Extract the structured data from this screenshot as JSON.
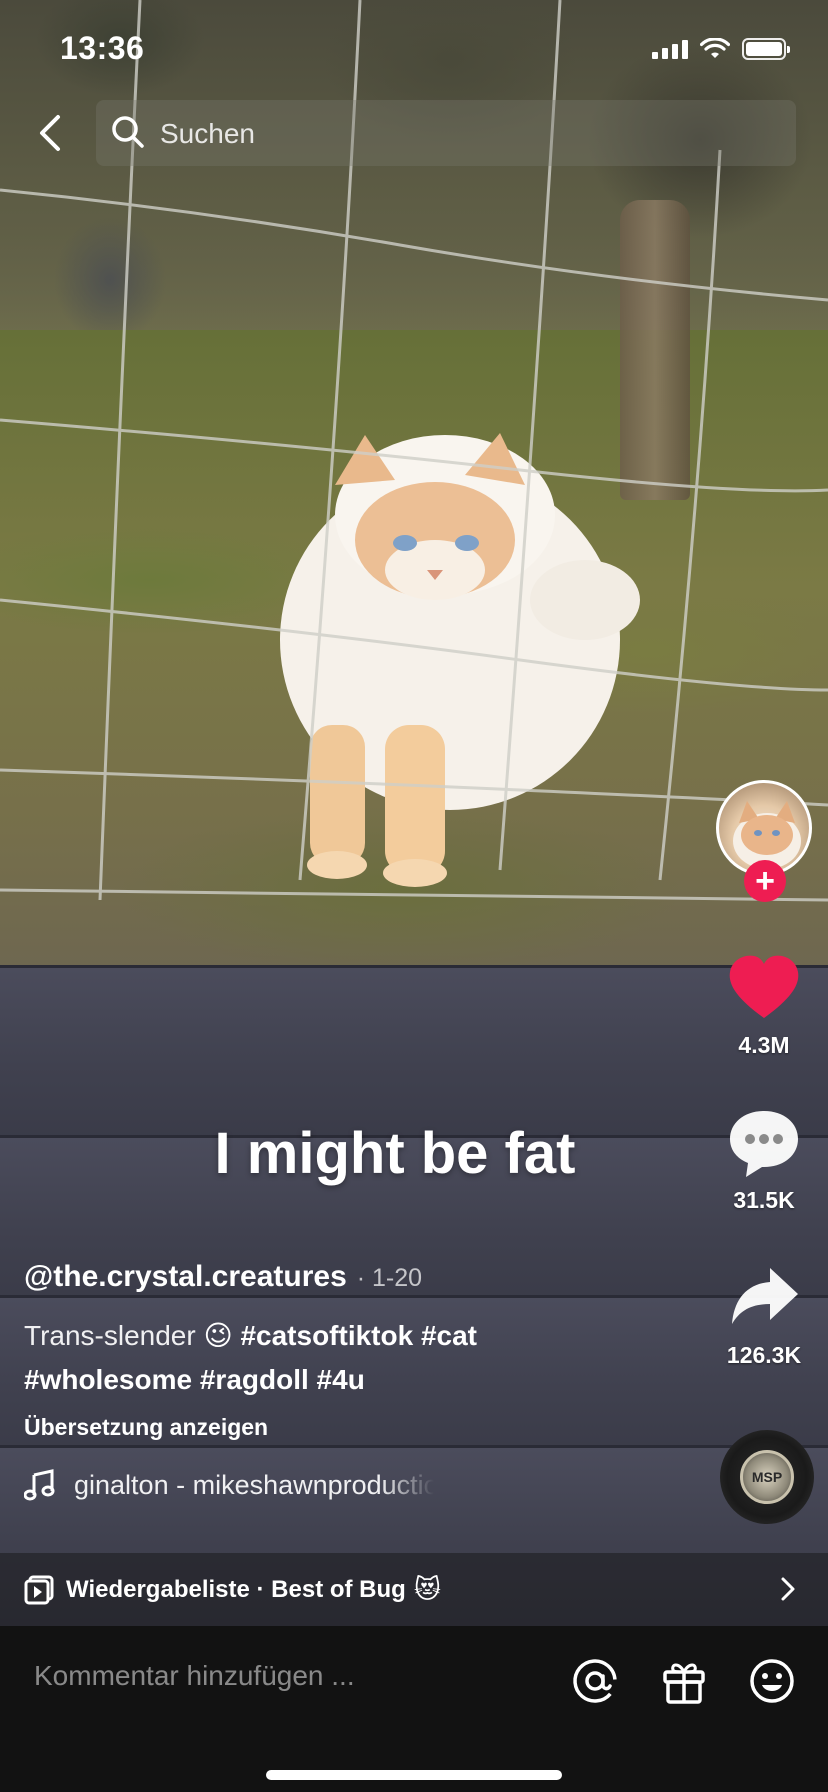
{
  "status_bar": {
    "time": "13:36"
  },
  "search": {
    "placeholder": "Suchen"
  },
  "video": {
    "overlay_caption": "I might be fat"
  },
  "actions": {
    "likes": "4.3M",
    "comments": "31.5K",
    "shares": "126.3K",
    "follow_symbol": "+",
    "disc_label": "MSP"
  },
  "post": {
    "author": "@the.crystal.creatures",
    "date": "· 1-20",
    "description_text": "Trans-slender",
    "emoji": "😉",
    "hashtags": [
      "#catsoftiktok",
      "#cat",
      "#wholesome",
      "#ragdoll",
      "#4u"
    ],
    "translate_label": "Übersetzung anzeigen",
    "music": "ginalton - mikeshawnproduction"
  },
  "playlist": {
    "label": "Wiedergabeliste · Best of Bug",
    "emoji": "😻"
  },
  "comment_bar": {
    "placeholder": "Kommentar hinzufügen ..."
  },
  "colors": {
    "accent": "#ee1d52",
    "like": "#ee1d52",
    "comment_bar_bg": "#121212"
  },
  "icons": [
    "back-icon",
    "search-icon",
    "heart-icon",
    "comment-icon",
    "share-icon",
    "music-note-icon",
    "playlist-icon",
    "chevron-right-icon",
    "at-icon",
    "gift-icon",
    "emoji-icon"
  ]
}
